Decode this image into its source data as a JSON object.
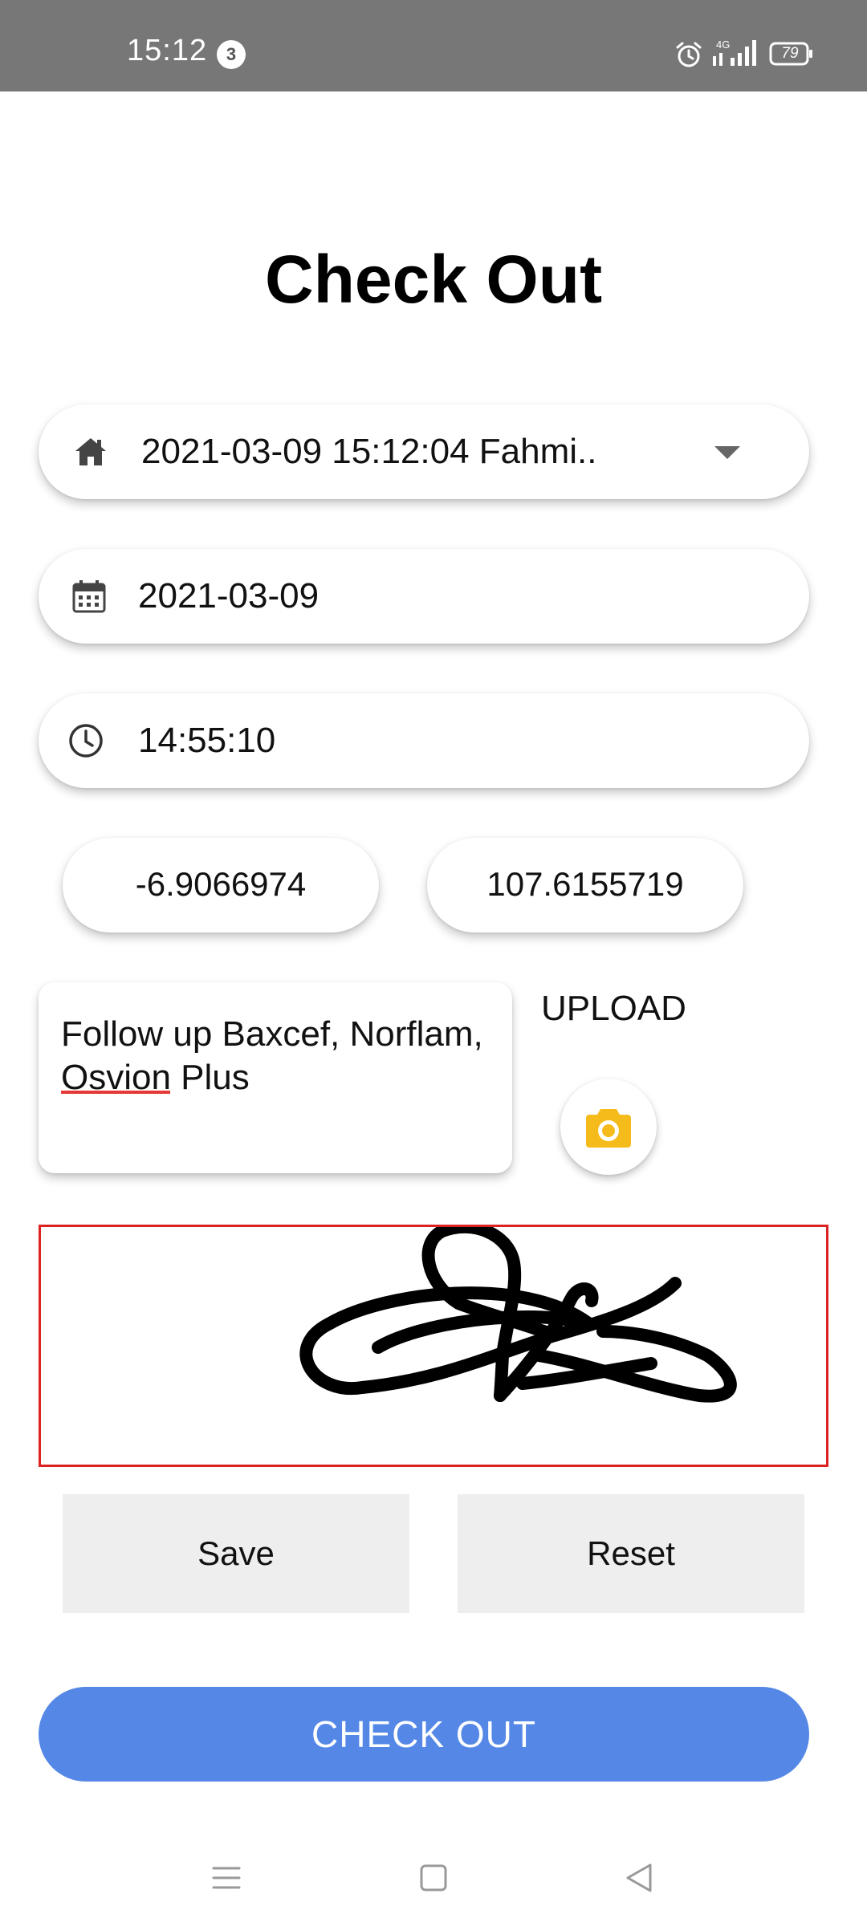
{
  "status_bar": {
    "time": "15:12",
    "notification_count": "3",
    "network": "4G",
    "battery": "79"
  },
  "page": {
    "title": "Check Out"
  },
  "form": {
    "visit_selected": "2021-03-09 15:12:04 Fahmi..",
    "date_value": "2021-03-09",
    "time_value": "14:55:10",
    "latitude": "-6.9066974",
    "longitude": "107.6155719",
    "notes": "Follow up Baxcef, Norflam, Osvion Plus",
    "upload_label": "UPLOAD"
  },
  "signature": {
    "border_color": "#dd2222"
  },
  "buttons": {
    "save_label": "Save",
    "reset_label": "Reset",
    "checkout_label": "CHECK OUT"
  },
  "colors": {
    "status_bar_bg": "#777777",
    "checkout_bg": "#5588e6",
    "camera_icon": "#f5bb1a",
    "flat_button_bg": "#eeeeee"
  },
  "icons": {
    "visit": "home-icon",
    "date": "calendar-icon",
    "time": "clock-icon",
    "upload": "camera-icon",
    "dropdown": "caret-down-icon"
  }
}
